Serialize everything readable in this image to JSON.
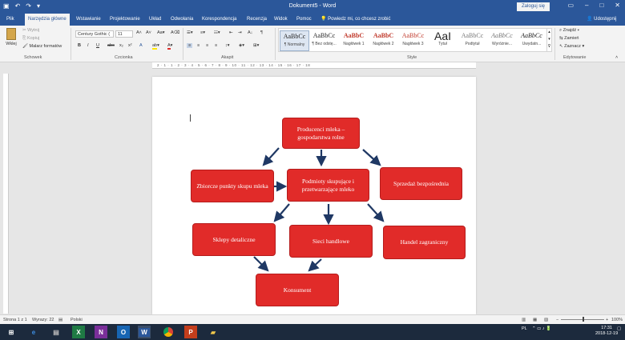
{
  "window": {
    "title": "Dokument5 - Word",
    "login_label": "Zaloguj się",
    "qat": [
      "save-icon",
      "undo-icon",
      "redo-icon",
      "customize-icon"
    ]
  },
  "tabs": [
    {
      "label": "Plik",
      "active": false
    },
    {
      "label": "Narzędzia główne",
      "active": true
    },
    {
      "label": "Wstawianie",
      "active": false
    },
    {
      "label": "Projektowanie",
      "active": false
    },
    {
      "label": "Układ",
      "active": false
    },
    {
      "label": "Odwołania",
      "active": false
    },
    {
      "label": "Korespondencja",
      "active": false
    },
    {
      "label": "Recenzja",
      "active": false
    },
    {
      "label": "Widok",
      "active": false
    },
    {
      "label": "Pomoc",
      "active": false
    }
  ],
  "tellme": "Powiedz mi, co chcesz zrobić",
  "share": "Udostępnij",
  "ribbon": {
    "clipboard": {
      "paste": "Wklej",
      "cut": "Wytnij",
      "copy": "Kopiuj",
      "format_painter": "Malarz formatów",
      "group": "Schowek"
    },
    "font": {
      "family": "Century Gothic (",
      "size": "11",
      "group": "Czcionka",
      "buttons": [
        "B",
        "I",
        "U",
        "abc",
        "x₂",
        "x²",
        "A",
        "A"
      ]
    },
    "paragraph": {
      "group": "Akapit"
    },
    "styles": {
      "group": "Style",
      "items": [
        {
          "sample": "AaBbCc",
          "name": "¶ Normalny"
        },
        {
          "sample": "AaBbCc",
          "name": "¶ Bez odstę..."
        },
        {
          "sample": "AaBbC",
          "name": "Nagłówek 1"
        },
        {
          "sample": "AaBbC",
          "name": "Nagłówek 2"
        },
        {
          "sample": "AaBbCc",
          "name": "Nagłówek 3"
        },
        {
          "sample": "AaI",
          "name": "Tytuł"
        },
        {
          "sample": "AaBbCc",
          "name": "Podtytuł"
        },
        {
          "sample": "AaBbCc",
          "name": "Wyróżnie..."
        },
        {
          "sample": "AaBbCc",
          "name": "Uwydatn..."
        }
      ]
    },
    "editing": {
      "group": "Edytowanie",
      "find": "Znajdź",
      "replace": "Zamień",
      "select": "Zaznacz"
    }
  },
  "ruler_numbers": "2 · 1 · 1 · 2 · 3 · 4 · 5 · 6 · 7 · 8 · 9 · 10 · 11 · 12 · 13 · 14 · 15 · 16 · 17 · 18",
  "diagram": {
    "nodes": [
      {
        "id": "producers",
        "text": "Producenci mleka – gospodarstwa rolne"
      },
      {
        "id": "collection",
        "text": "Zbiorcze punkty skupu mleka"
      },
      {
        "id": "processors",
        "text": "Podmioty skupujące i przetwarzające mleko"
      },
      {
        "id": "direct",
        "text": "Sprzedaż bezpośrednia"
      },
      {
        "id": "retail",
        "text": "Sklepy detaliczne"
      },
      {
        "id": "chains",
        "text": "Sieci handlowe"
      },
      {
        "id": "foreign",
        "text": "Handel zagraniczny"
      },
      {
        "id": "consumer",
        "text": "Konsument"
      }
    ],
    "node_color": "#e12b29",
    "arrow_color": "#1f3864"
  },
  "status": {
    "page": "Strona 1 z 1",
    "words": "Wyrazy: 22",
    "language": "Polski",
    "zoom": "100%"
  },
  "taskbar": {
    "icons": [
      "windows-icon",
      "search-icon",
      "edge-icon",
      "excel-icon",
      "onenote-icon",
      "outlook-icon",
      "word-icon",
      "chrome-icon",
      "powerpoint-icon",
      "explorer-icon"
    ],
    "lang": "PL",
    "time": "17:31",
    "date": "2018-12-19"
  }
}
